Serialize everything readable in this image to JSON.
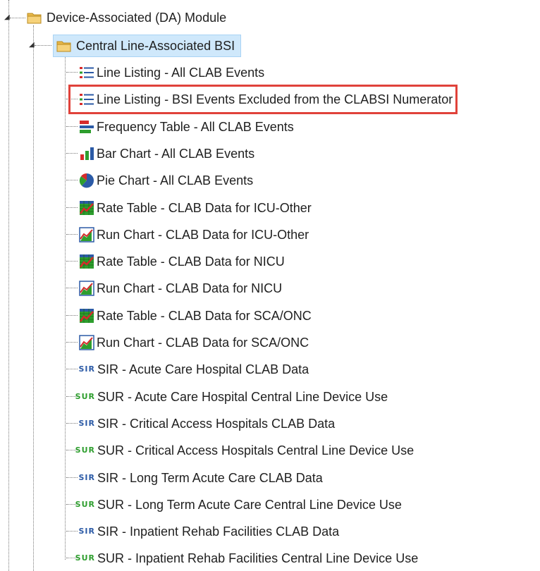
{
  "tree": {
    "module": {
      "label": "Device-Associated (DA) Module",
      "icon": "folder-icon"
    },
    "group": {
      "label": "Central Line-Associated BSI",
      "icon": "folder-icon",
      "selected": true
    },
    "items": [
      {
        "label": "Line Listing - All CLAB Events",
        "icon": "line-listing-icon"
      },
      {
        "label": "Line Listing - BSI Events Excluded from the CLABSI Numerator",
        "icon": "line-listing-icon",
        "highlighted": true
      },
      {
        "label": "Frequency Table - All CLAB Events",
        "icon": "frequency-table-icon"
      },
      {
        "label": "Bar Chart - All CLAB Events",
        "icon": "bar-chart-icon"
      },
      {
        "label": "Pie Chart - All CLAB Events",
        "icon": "pie-chart-icon"
      },
      {
        "label": "Rate Table - CLAB Data for ICU-Other",
        "icon": "rate-table-icon"
      },
      {
        "label": "Run Chart - CLAB Data for ICU-Other",
        "icon": "run-chart-icon"
      },
      {
        "label": "Rate Table - CLAB Data for NICU",
        "icon": "rate-table-icon"
      },
      {
        "label": "Run Chart - CLAB Data for NICU",
        "icon": "run-chart-icon"
      },
      {
        "label": "Rate Table - CLAB Data for SCA/ONC",
        "icon": "rate-table-icon"
      },
      {
        "label": "Run Chart - CLAB Data for SCA/ONC",
        "icon": "run-chart-icon"
      },
      {
        "label": "SIR - Acute Care Hospital CLAB Data",
        "icon": "sir-icon",
        "badge": "SIR"
      },
      {
        "label": "SUR - Acute Care Hospital Central Line Device Use",
        "icon": "sur-icon",
        "badge": "SUR"
      },
      {
        "label": "SIR - Critical Access Hospitals CLAB Data",
        "icon": "sir-icon",
        "badge": "SIR"
      },
      {
        "label": "SUR - Critical Access Hospitals Central Line Device Use",
        "icon": "sur-icon",
        "badge": "SUR"
      },
      {
        "label": "SIR - Long Term Acute Care CLAB Data",
        "icon": "sir-icon",
        "badge": "SIR"
      },
      {
        "label": "SUR - Long Term Acute Care Central Line Device Use",
        "icon": "sur-icon",
        "badge": "SUR"
      },
      {
        "label": "SIR - Inpatient Rehab Facilities CLAB Data",
        "icon": "sir-icon",
        "badge": "SIR"
      },
      {
        "label": "SUR - Inpatient Rehab Facilities Central Line Device Use",
        "icon": "sur-icon",
        "badge": "SUR"
      }
    ]
  },
  "colors": {
    "selection_bg": "#cfe8fb",
    "highlight_border": "#e0423a",
    "sir_badge": "#2b5aa6",
    "sur_badge": "#2e9e2e"
  }
}
